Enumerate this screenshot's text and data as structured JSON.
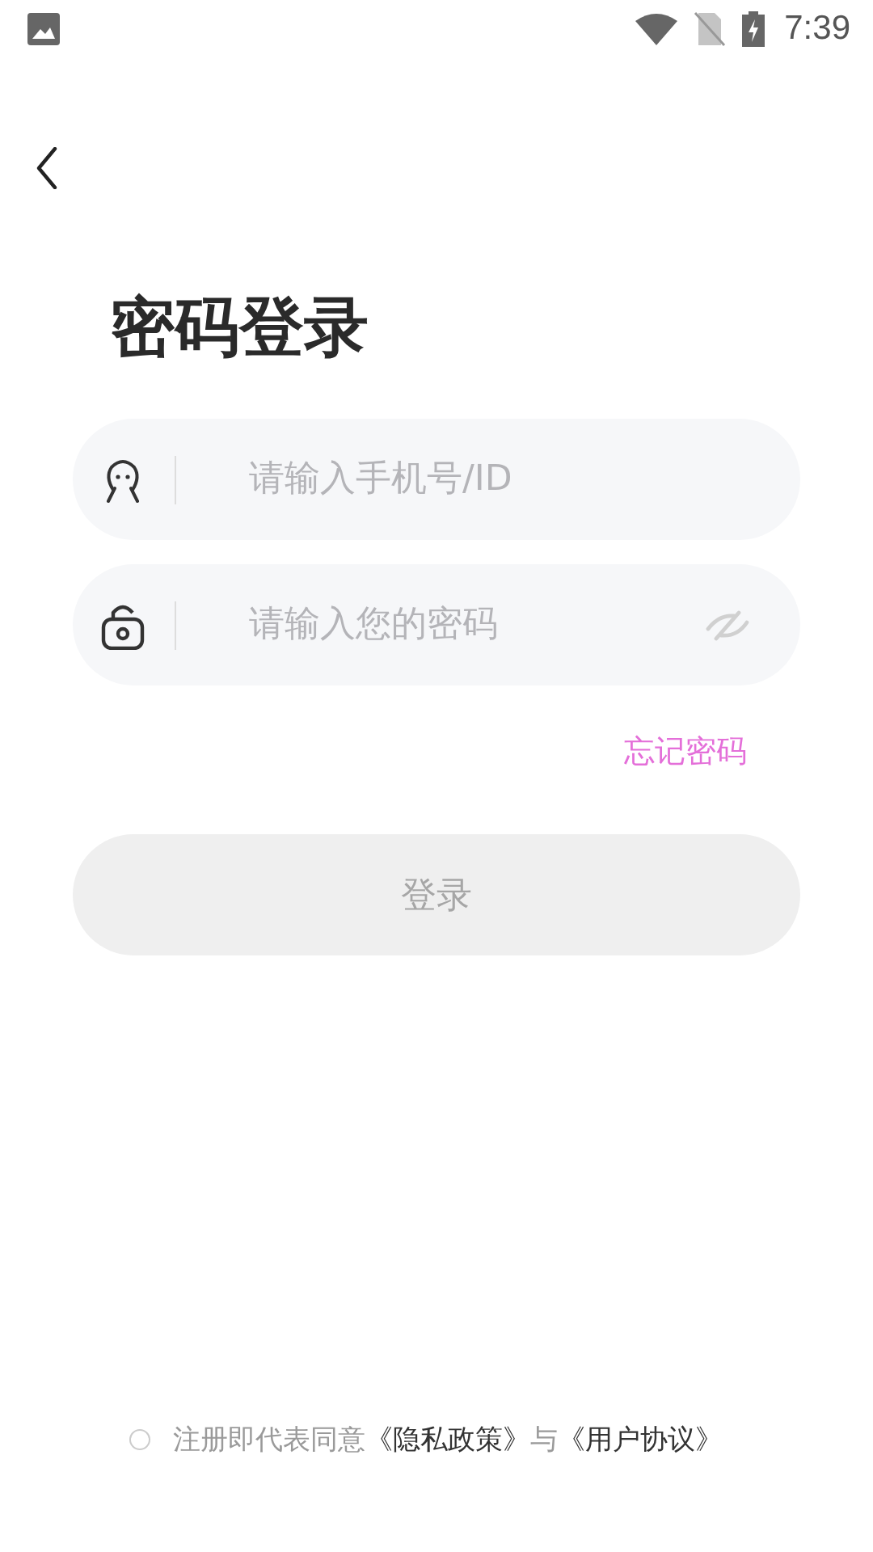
{
  "status_bar": {
    "time": "7:39"
  },
  "title": "密码登录",
  "fields": [
    {
      "kind": "account",
      "placeholder": "请输入手机号/ID"
    },
    {
      "kind": "password",
      "placeholder": "请输入您的密码",
      "visible": false
    }
  ],
  "forgot_link": "忘记密码",
  "login_button": {
    "label": "登录",
    "disabled": true
  },
  "agreement": {
    "checked": false,
    "parts": [
      {
        "kind": "text",
        "text": "注册即代表同意"
      },
      {
        "kind": "link",
        "text": "《隐私政策》"
      },
      {
        "kind": "text",
        "text": "与"
      },
      {
        "kind": "link",
        "text": "《用户协议》"
      }
    ]
  }
}
